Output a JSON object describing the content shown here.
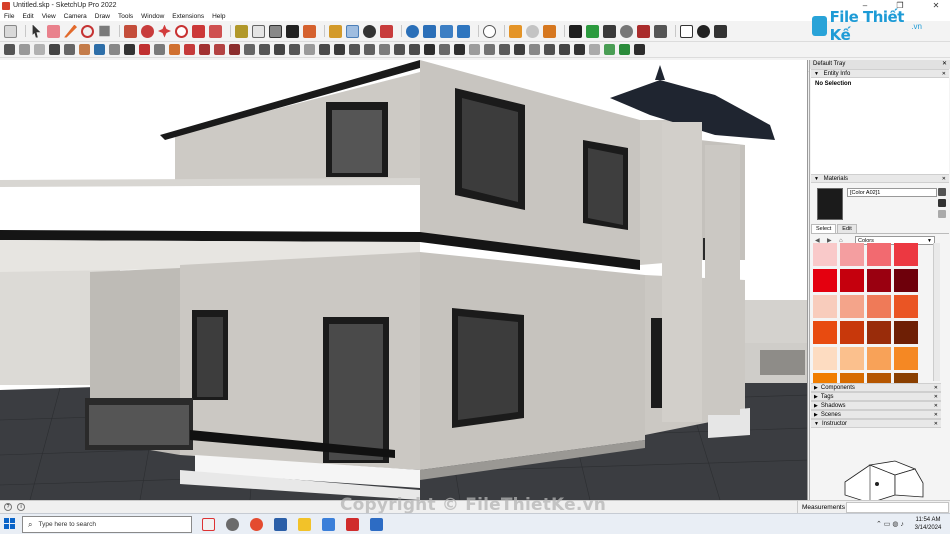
{
  "window": {
    "title": "Untitled.skp - SketchUp Pro 2022",
    "controls": [
      "–",
      "❐",
      "✕"
    ]
  },
  "menu": [
    "File",
    "Edit",
    "View",
    "Camera",
    "Draw",
    "Tools",
    "Window",
    "Extensions",
    "Help"
  ],
  "brand": {
    "name": "File Thiết Kế",
    "suffix": ".vn"
  },
  "tray": {
    "title": "Default Tray",
    "entity_info": {
      "label": "Entity Info",
      "value": "No Selection"
    },
    "materials": {
      "label": "Materials",
      "current_name": "[Color A02]1",
      "tabs": [
        "Select",
        "Edit"
      ],
      "library": "Colors",
      "swatches": [
        "#f9c9c9",
        "#f49ea0",
        "#f26a70",
        "#ec3841",
        "#e4000f",
        "#c5000d",
        "#9a0010",
        "#6e000b",
        "#f8ccbc",
        "#f4a48a",
        "#ef7a58",
        "#ea5524",
        "#e84b10",
        "#c8380b",
        "#992c0a",
        "#6e1f05",
        "#fddcc1",
        "#fbc08d",
        "#f8a258",
        "#f58823",
        "#f07d00",
        "#d76b00",
        "#b55600",
        "#8a3f00"
      ]
    },
    "panels": [
      "Components",
      "Tags",
      "Shadows",
      "Scenes",
      "Instructor"
    ]
  },
  "status": {
    "measurements_label": "Measurements",
    "measurements_value": ""
  },
  "taskbar": {
    "search_placeholder": "Type here to search",
    "time": "11:54 AM",
    "date": "3/14/2024"
  },
  "watermark": "Copyright © FileThietKe.vn",
  "colors": {
    "sky": "#ffffff",
    "wall": "#c9c6c1",
    "floor": "#3a3c40",
    "roof_dark": "#1f2530",
    "accent_red": "#e4000f"
  }
}
